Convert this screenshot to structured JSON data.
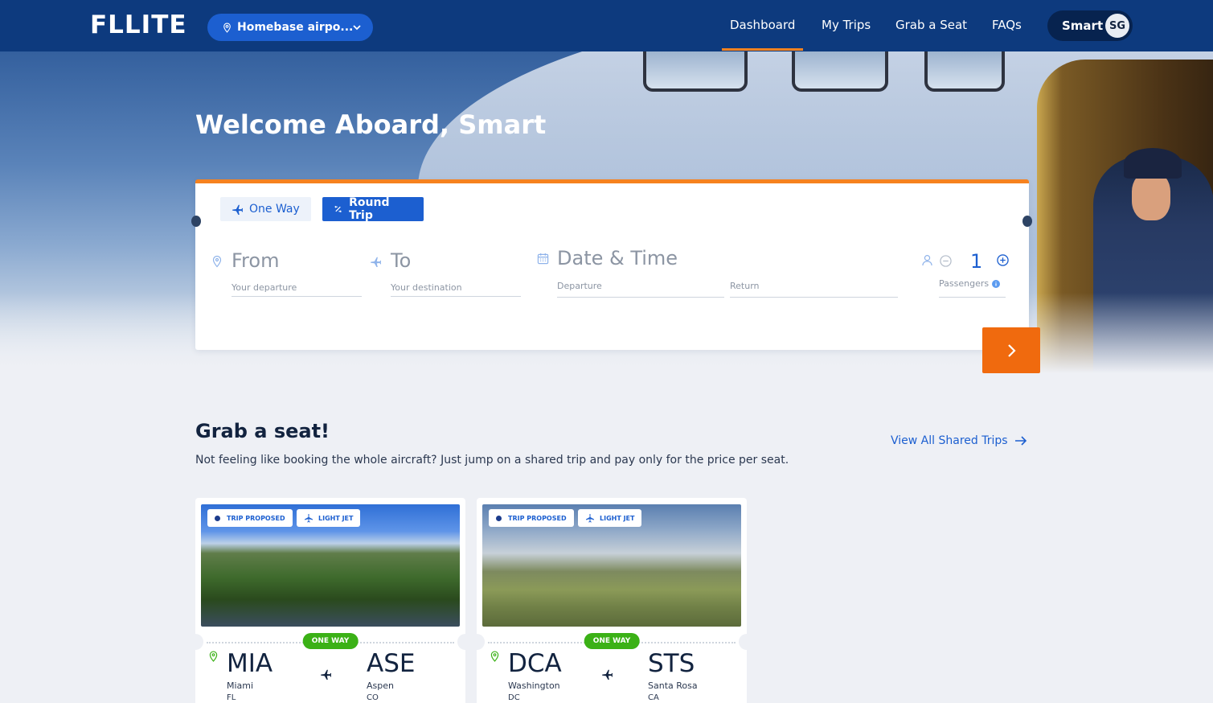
{
  "nav": {
    "logo": "FLLITE",
    "airport_select": "Homebase airpo...",
    "links": [
      "Dashboard",
      "My Trips",
      "Grab a Seat",
      "FAQs"
    ],
    "active_link": "Dashboard",
    "user_name": "Smart",
    "user_initials": "SG"
  },
  "hero": {
    "welcome": "Welcome Aboard, Smart"
  },
  "search": {
    "trip_types": [
      "One Way",
      "Round Trip"
    ],
    "selected_trip_type": "Round Trip",
    "from": {
      "label": "From",
      "placeholder": "Your departure"
    },
    "to": {
      "label": "To",
      "placeholder": "Your destination"
    },
    "date": {
      "label": "Date & Time",
      "departure": "Departure",
      "return": "Return"
    },
    "passengers": {
      "count": "1",
      "label": "Passengers"
    }
  },
  "grab": {
    "title": "Grab a seat!",
    "subtitle": "Not feeling like booking the whole aircraft? Just jump on a shared trip and pay only for the price per seat.",
    "view_all": "View All Shared Trips",
    "trips": [
      {
        "status": "TRIP PROPOSED",
        "aircraft": "LIGHT JET",
        "type": "ONE WAY",
        "from_code": "MIA",
        "from_city": "Miami",
        "from_state": "FL",
        "to_code": "ASE",
        "to_city": "Aspen",
        "to_state": "CO"
      },
      {
        "status": "TRIP PROPOSED",
        "aircraft": "LIGHT JET",
        "type": "ONE WAY",
        "from_code": "DCA",
        "from_city": "Washington",
        "from_state": "DC",
        "to_code": "STS",
        "to_city": "Santa Rosa",
        "to_state": "CA"
      }
    ]
  },
  "colors": {
    "navy": "#0d3a7e",
    "primary": "#1c5fd0",
    "accent": "#f6821f",
    "green": "#3bb116"
  }
}
